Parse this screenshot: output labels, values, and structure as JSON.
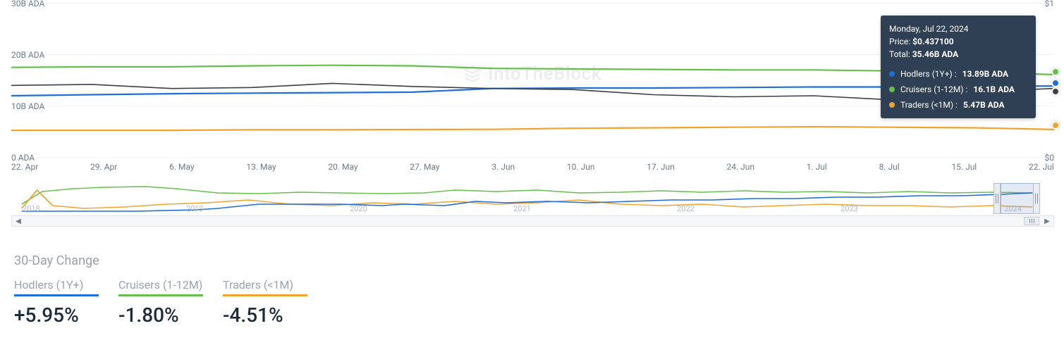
{
  "chart_data": {
    "type": "line",
    "title": "",
    "xlabel": "",
    "ylabel": "ADA",
    "y_left_ticks": [
      "0 ADA",
      "10B ADA",
      "20B ADA",
      "30B ADA"
    ],
    "y_right_ticks": [
      "$0",
      "$1"
    ],
    "ylim_left": [
      0,
      30
    ],
    "categories": [
      "22. Apr",
      "29. Apr",
      "6. May",
      "13. May",
      "20. May",
      "27. May",
      "3. Jun",
      "10. Jun",
      "17. Jun",
      "24. Jun",
      "1. Jul",
      "8. Jul",
      "15. Jul",
      "22. Jul"
    ],
    "series": [
      {
        "name": "Hodlers (1Y+)",
        "color": "#1f6fd6",
        "values": [
          12.0,
          12.2,
          12.4,
          12.5,
          12.6,
          12.7,
          13.4,
          13.5,
          13.5,
          13.6,
          13.7,
          13.7,
          13.8,
          13.89
        ]
      },
      {
        "name": "Cruisers (1-12M)",
        "color": "#63c04a",
        "values": [
          17.5,
          17.6,
          17.6,
          17.8,
          17.9,
          17.8,
          17.3,
          17.2,
          17.1,
          17.0,
          17.0,
          16.8,
          16.5,
          16.1
        ]
      },
      {
        "name": "Traders (<1M)",
        "color": "#f0a32f",
        "values": [
          5.3,
          5.3,
          5.3,
          5.4,
          5.4,
          5.45,
          5.5,
          5.7,
          5.8,
          5.9,
          6.0,
          5.9,
          5.8,
          5.47
        ]
      },
      {
        "name": "Price",
        "color": "#3b3f46",
        "values": [
          14.0,
          14.2,
          13.4,
          13.6,
          14.4,
          13.8,
          13.4,
          13.2,
          12.2,
          11.8,
          12.0,
          11.2,
          12.8,
          13.4
        ]
      }
    ],
    "watermark": "IntoTheBlock"
  },
  "tooltip": {
    "date": "Monday, Jul 22, 2024",
    "price_label": "Price:",
    "price_value": "$0.437100",
    "total_label": "Total:",
    "total_value": "35.46B ADA",
    "items": [
      {
        "label": "Hodlers (1Y+) :",
        "value": "13.89B ADA",
        "color": "#1f6fd6"
      },
      {
        "label": "Cruisers (1-12M) :",
        "value": "16.1B ADA",
        "color": "#63c04a"
      },
      {
        "label": "Traders (<1M) :",
        "value": "5.47B ADA",
        "color": "#f0a32f"
      }
    ]
  },
  "navigator": {
    "years": [
      "2018",
      "2019",
      "2020",
      "2021",
      "2022",
      "2023",
      "2024"
    ]
  },
  "summary": {
    "title": "30-Day Change",
    "items": [
      {
        "label": "Hodlers (1Y+)",
        "value": "+5.95%",
        "color": "#1f6fd6"
      },
      {
        "label": "Cruisers (1-12M)",
        "value": "-1.80%",
        "color": "#63c04a"
      },
      {
        "label": "Traders (<1M)",
        "value": "-4.51%",
        "color": "#f0a32f"
      }
    ]
  }
}
